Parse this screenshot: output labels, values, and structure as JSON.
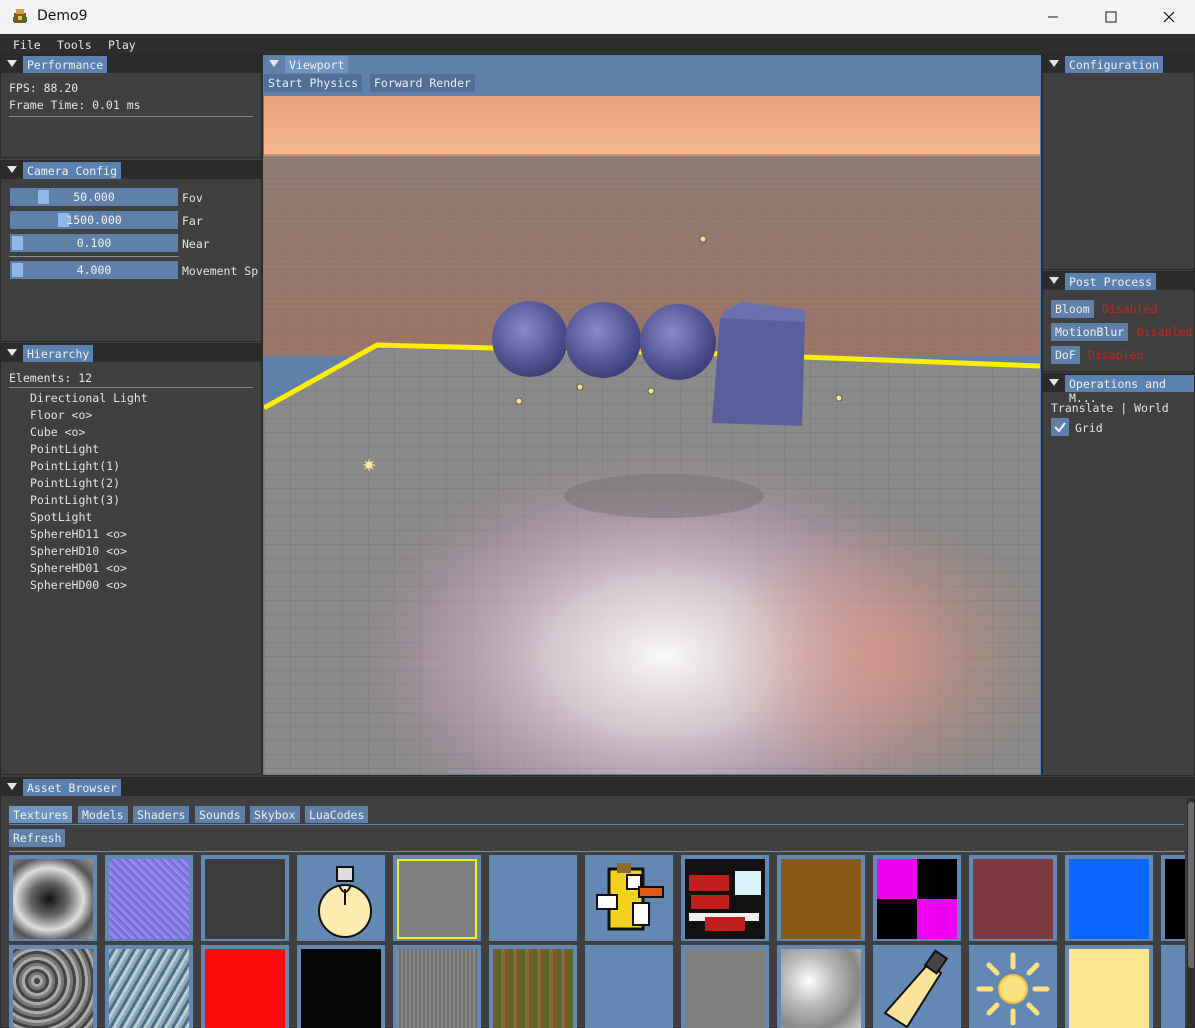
{
  "window": {
    "title": "Demo9"
  },
  "menu": [
    "File",
    "Tools",
    "Play"
  ],
  "performance": {
    "tab": "Performance",
    "fps": "FPS: 88.20",
    "frame_time": "Frame Time: 0.01 ms"
  },
  "camera": {
    "tab": "Camera Config",
    "sliders": [
      {
        "value": "50.000",
        "label": "Fov",
        "level": 0.19
      },
      {
        "value": "1500.000",
        "label": "Far",
        "level": 0.31
      },
      {
        "value": "0.100",
        "label": "Near",
        "level": 0.0
      },
      {
        "value": "4.000",
        "label": "Movement Sp",
        "level": 0.0
      }
    ]
  },
  "hierarchy": {
    "tab": "Hierarchy",
    "count": "Elements: 12",
    "items": [
      "Directional Light",
      "Floor <o>",
      "Cube <o>",
      "PointLight",
      "PointLight(1)",
      "PointLight(2)",
      "PointLight(3)",
      "SpotLight",
      "SphereHD11 <o>",
      "SphereHD10 <o>",
      "SphereHD01 <o>",
      "SphereHD00 <o>"
    ]
  },
  "viewport": {
    "tab": "Viewport",
    "start_physics": "Start Physics",
    "forward_render": "Forward Render"
  },
  "configuration": {
    "tab": "Configuration"
  },
  "post_process": {
    "tab": "Post Process",
    "effects": [
      {
        "name": "Bloom",
        "state": "Disabled"
      },
      {
        "name": "MotionBlur",
        "state": "Disabled"
      },
      {
        "name": "DoF",
        "state": "Disabled"
      }
    ]
  },
  "operations": {
    "tab": "Operations and M...",
    "mode": "Translate | World",
    "grid_label": "Grid",
    "grid_checked": true
  },
  "assets": {
    "tab": "Asset Browser",
    "tabs": [
      "Textures",
      "Models",
      "Shaders",
      "Sounds",
      "Skybox",
      "LuaCodes"
    ],
    "refresh": "Refresh"
  },
  "colors": {
    "accent": "#5f80a9",
    "panel_bg": "#3f3f3f",
    "disabled_text": "#d21e1e",
    "grid_line": "#ffee00"
  }
}
